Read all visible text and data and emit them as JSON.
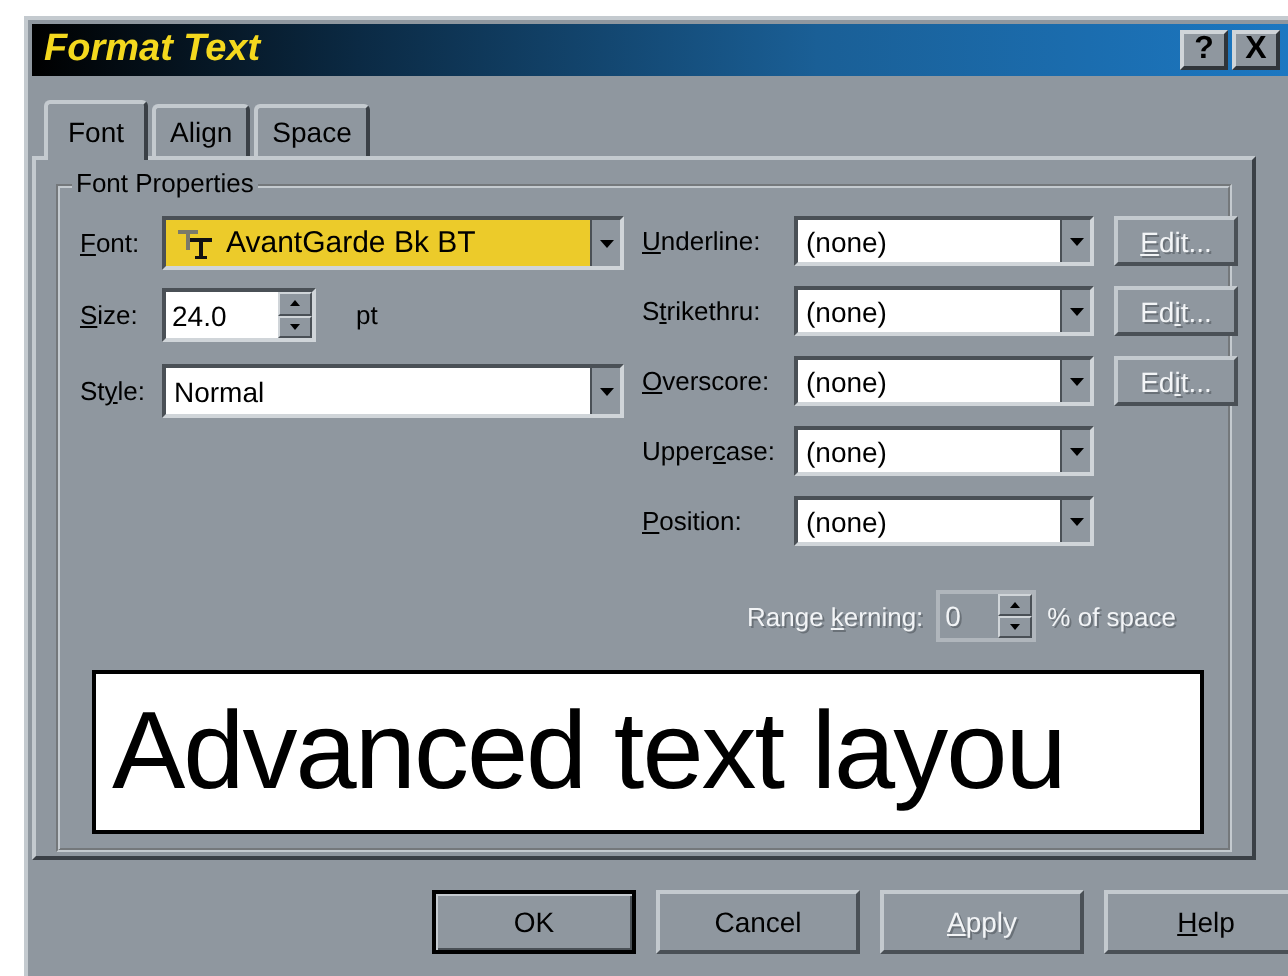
{
  "window": {
    "title": "Format Text",
    "title_buttons": [
      "?",
      "X"
    ]
  },
  "tabs": [
    {
      "label": "Font",
      "selected": true
    },
    {
      "label": "Align",
      "selected": false
    },
    {
      "label": "Space",
      "selected": false
    }
  ],
  "group_title": "Font Properties",
  "font": {
    "label": {
      "key": "F",
      "after": "ont:"
    },
    "value": "AvantGarde Bk BT",
    "focused": true
  },
  "size": {
    "label": {
      "key": "S",
      "after": "ize:"
    },
    "value": "24.0",
    "unit": "pt"
  },
  "style": {
    "label": {
      "before": "St",
      "key": "y",
      "after": "le:"
    },
    "value": "Normal"
  },
  "effects": [
    {
      "label": {
        "key": "U",
        "after": "nderline:"
      },
      "value": "(none)",
      "edit": {
        "key": "E",
        "after": "dit...",
        "disabled": true
      }
    },
    {
      "label": {
        "before": "S",
        "key": "t",
        "after": "rikethru:"
      },
      "value": "(none)",
      "edit": {
        "before": "Ed",
        "key": "i",
        "after": "t...",
        "disabled": true
      }
    },
    {
      "label": {
        "key": "O",
        "after": "verscore:"
      },
      "value": "(none)",
      "edit": {
        "before": "Ed",
        "key": "i",
        "after": "t...",
        "disabled": true
      }
    },
    {
      "label": {
        "before": "Upper",
        "key": "c",
        "after": "ase:"
      },
      "value": "(none)"
    },
    {
      "label": {
        "key": "P",
        "after": "osition:"
      },
      "value": "(none)"
    }
  ],
  "kerning": {
    "label": {
      "before": "Range ",
      "key": "k",
      "after": "erning:"
    },
    "value": "0",
    "unit": "% of space",
    "disabled": true
  },
  "preview": "Advanced text layou",
  "buttons": [
    {
      "label": {
        "after": "OK"
      },
      "default": true,
      "disabled": false
    },
    {
      "label": {
        "after": "Cancel"
      },
      "default": false,
      "disabled": false
    },
    {
      "label": {
        "key": "A",
        "after": "pply"
      },
      "default": false,
      "disabled": true
    },
    {
      "label": {
        "key": "H",
        "after": "elp"
      },
      "default": false,
      "disabled": false
    }
  ]
}
